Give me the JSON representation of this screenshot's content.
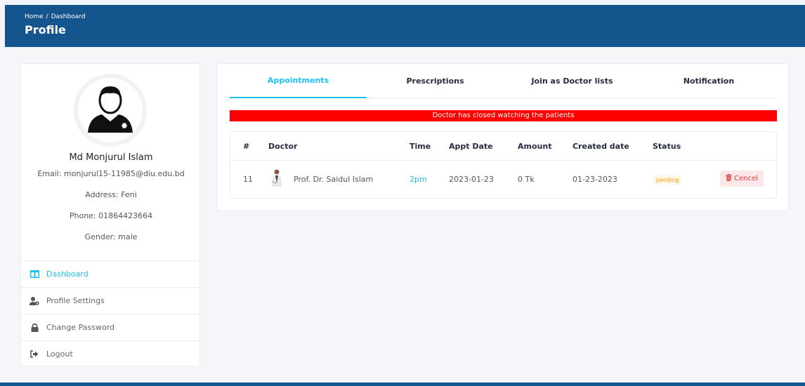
{
  "header": {
    "breadcrumb": {
      "home": "Home",
      "separator": "/",
      "current": "Dashboard"
    },
    "title": "Profile"
  },
  "profile": {
    "avatar_icon": "doctor-avatar-icon",
    "name": "Md Monjurul Islam",
    "email": "Email: monjurul15-11985@diu.edu.bd",
    "address": "Address: Feni",
    "phone": "Phone: 01864423664",
    "gender": "Gender: male"
  },
  "menu": {
    "items": [
      {
        "label": "Dashboard",
        "icon": "dashboard-icon"
      },
      {
        "label": "Profile Settings",
        "icon": "user-cog-icon"
      },
      {
        "label": "Change Password",
        "icon": "lock-icon"
      },
      {
        "label": "Logout",
        "icon": "logout-icon"
      }
    ]
  },
  "tabs": [
    {
      "label": "Appointments"
    },
    {
      "label": "Prescriptions"
    },
    {
      "label": "Join as Doctor lists"
    },
    {
      "label": "Notification"
    }
  ],
  "alert": "Doctor has closed watching the patients",
  "table": {
    "headers": [
      "#",
      "Doctor",
      "Time",
      "Appt Date",
      "Amount",
      "Created date",
      "Status"
    ],
    "rows": [
      {
        "id": "11",
        "doctor": "Prof. Dr. Saidul Islam",
        "time": "2pm",
        "appt_date": "2023-01-23",
        "amount": "0 Tk",
        "created": "01-23-2023",
        "status": "pending",
        "action": "Cencel"
      }
    ]
  },
  "colors": {
    "header_bg": "#15558d",
    "accent": "#20c0f3",
    "alert": "#ff0000",
    "pending": "#f39c12",
    "cancel": "#e63c3c"
  }
}
